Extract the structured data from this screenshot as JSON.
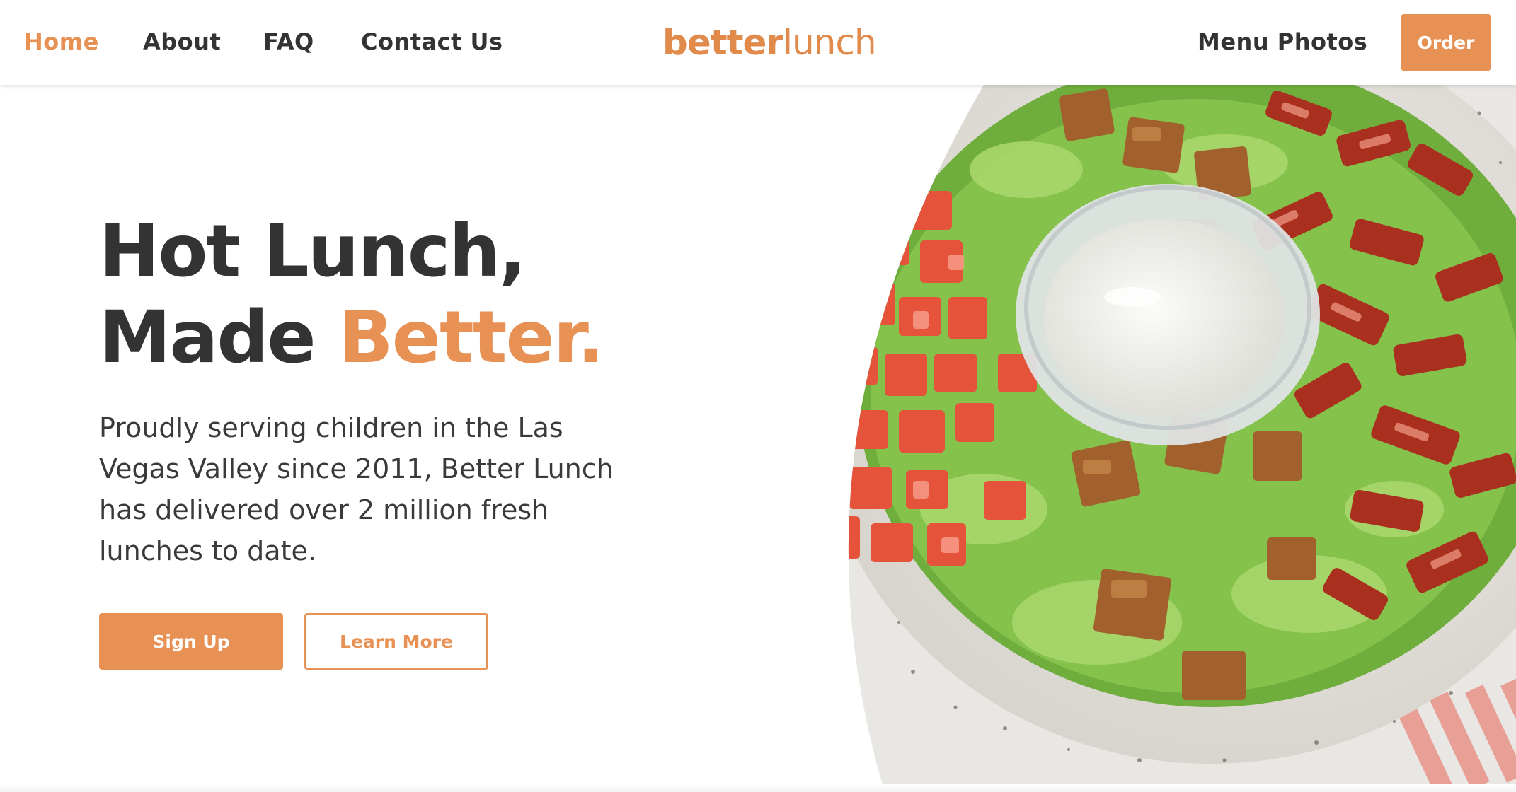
{
  "nav": {
    "left_links": [
      {
        "label": "Home",
        "active": true
      },
      {
        "label": "About"
      },
      {
        "label": "FAQ"
      },
      {
        "label": "Contact Us"
      }
    ],
    "logo": {
      "bold": "better",
      "light": "lunch"
    },
    "right_link": "Menu Photos",
    "order_label": "Order"
  },
  "hero": {
    "title_line1": "Hot Lunch,",
    "title_line2_plain": "Made ",
    "title_line2_accent": "Better.",
    "description": "Proudly serving children in the Las Vegas Valley since 2011, Better Lunch has delivered over 2 million fresh lunches to date.",
    "primary_button": "Sign Up",
    "secondary_button": "Learn More"
  },
  "colors": {
    "accent": "#e89155",
    "text": "#333333"
  },
  "image": {
    "subject": "salad-bowl-photo"
  }
}
